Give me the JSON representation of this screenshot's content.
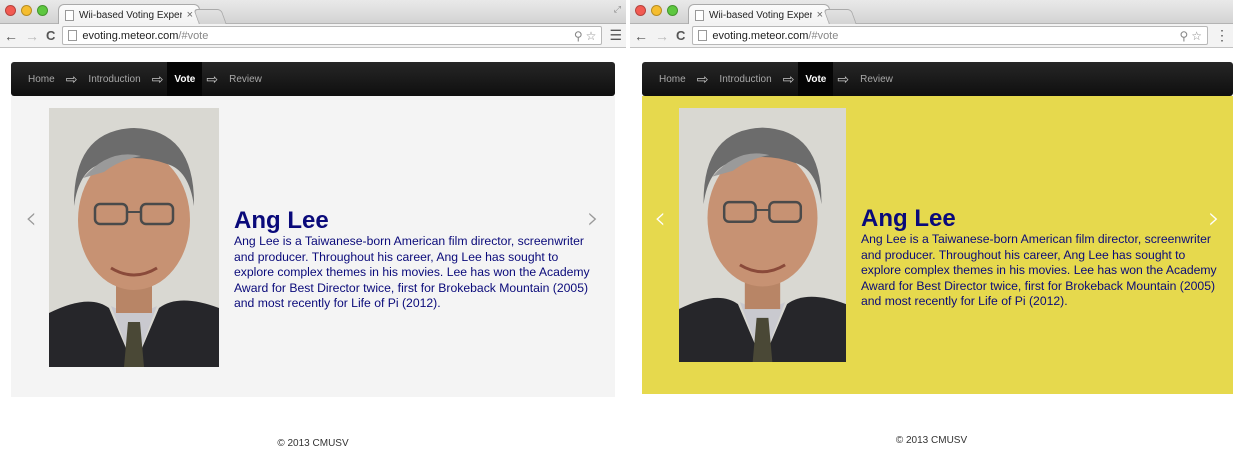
{
  "browser": {
    "tab_title": "Wii-based Voting Experien",
    "tab_close": "×",
    "url_host": "evoting.meteor.com",
    "url_path": "/#vote"
  },
  "nav": {
    "items": [
      {
        "label": "Home"
      },
      {
        "label": "Introduction"
      },
      {
        "label": "Vote",
        "active": true
      },
      {
        "label": "Review"
      }
    ],
    "arrow": "⇨"
  },
  "carousel": {
    "prev": "‹",
    "next": "›"
  },
  "slide": {
    "name": "Ang Lee",
    "bio": "Ang Lee is a Taiwanese-born American film director, screenwriter and producer. Throughout his career, Ang Lee has sought to explore complex themes in his movies. Lee has won the Academy Award for Best Director twice, first for Brokeback Mountain (2005) and most recently for Life of Pi (2012)."
  },
  "footer": {
    "text": "© 2013 CMUSV"
  },
  "colors": {
    "hero_left": "#f4f4f4",
    "hero_right": "#e6d94d",
    "caption_text": "#0a0a7a",
    "navbar": "#1a1a1a"
  }
}
